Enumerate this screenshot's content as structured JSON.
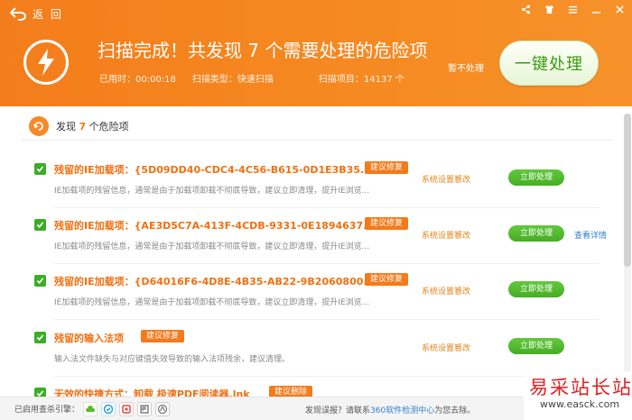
{
  "header": {
    "back_label": "返 回",
    "title": "扫描完成！共发现 7 个需要处理的危险项",
    "elapsed": "已用时：00:00:18",
    "scan_type": "扫描类型：快速扫描",
    "scan_items": "扫描项目：14137 个",
    "skip_label": "暂不处理",
    "fix_all_label": "一键处理",
    "colors": {
      "brand_orange": "#f68a22",
      "green": "#46ad24"
    }
  },
  "summary": {
    "prefix": "发现 ",
    "count": "7",
    "suffix": " 个危险项"
  },
  "items": [
    {
      "title": "残留的IE加载项：{5D09DD40-CDC4-4C56-B615-0D1E3B35...",
      "badge": "建议修复",
      "desc": "IE加载项的残留信息，通常是由于加载项卸载不彻底导致，建议立即清理，提升IE浏览...",
      "type": "系统设置篡改",
      "action": "立即处理",
      "link": ""
    },
    {
      "title": "残留的IE加载项：{AE3D5C7A-413F-4CDB-9331-0E1894637...",
      "badge": "建议修复",
      "desc": "IE加载项的残留信息，通常是由于加载项卸载不彻底导致，建议立即清理，提升IE浏览...",
      "type": "系统设置篡改",
      "action": "立即处理",
      "link": "查看详情"
    },
    {
      "title": "残留的IE加载项：{D64016F6-4D8E-4B35-AB22-9B2060800...",
      "badge": "建议修复",
      "desc": "IE加载项的残留信息，通常是由于加载项卸载不彻底导致，建议立即清理，提升IE浏览...",
      "type": "系统设置篡改",
      "action": "立即处理",
      "link": ""
    },
    {
      "title": "残留的输入法项",
      "badge": "建议修复",
      "desc": "输入法文件缺失与对应键值失效导致的输入法项残余，建议清理。",
      "type": "系统设置篡改",
      "action": "立即处理",
      "link": ""
    },
    {
      "title": "无效的快捷方式：卸载 极速PDF阅读器.lnk",
      "badge": "建议删除",
      "desc": "",
      "type": "",
      "action": "",
      "link": ""
    }
  ],
  "footer": {
    "engines_label": "已启用查杀引擎：",
    "report_prefix": "发现误报？请联系",
    "report_link": "360软件检测中心",
    "report_suffix": "为您去除。"
  },
  "watermark": {
    "title": "易采站长站",
    "url": "www.easck.com"
  }
}
